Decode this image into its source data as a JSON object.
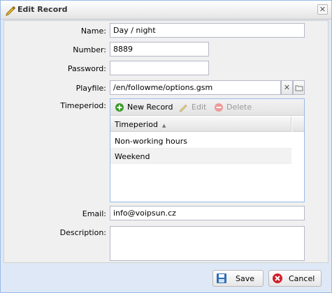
{
  "window": {
    "title": "Edit Record",
    "close_glyph": "✕"
  },
  "form": {
    "name": {
      "label": "Name:",
      "value": "Day / night"
    },
    "number": {
      "label": "Number:",
      "value": "8889"
    },
    "password": {
      "label": "Password:",
      "value": ""
    },
    "playfile": {
      "label": "Playfile:",
      "value": "/en/followme/options.gsm",
      "clear_glyph": "✕"
    },
    "timeperiod": {
      "label": "Timeperiod:",
      "toolbar": {
        "new_label": "New Record",
        "edit_label": "Edit",
        "delete_label": "Delete"
      },
      "column_header": "Timeperiod",
      "sort": "ascending",
      "rows": [
        "Non-working hours",
        "Weekend"
      ]
    },
    "email": {
      "label": "Email:",
      "value": "info@voipsun.cz"
    },
    "description": {
      "label": "Description:",
      "value": ""
    }
  },
  "buttons": {
    "save_label": "Save",
    "cancel_label": "Cancel"
  },
  "icons": {
    "title": "pencil-icon",
    "new": "plus-circle-icon",
    "edit": "pencil-icon",
    "delete": "minus-circle-icon",
    "save": "floppy-disk-icon",
    "cancel": "cancel-circle-icon",
    "browse": "folder-icon"
  },
  "colors": {
    "frame_border": "#99bbe8",
    "new_icon": "#3a9a2a",
    "cancel_icon": "#d0202a",
    "save_icon": "#2f6fb5"
  }
}
